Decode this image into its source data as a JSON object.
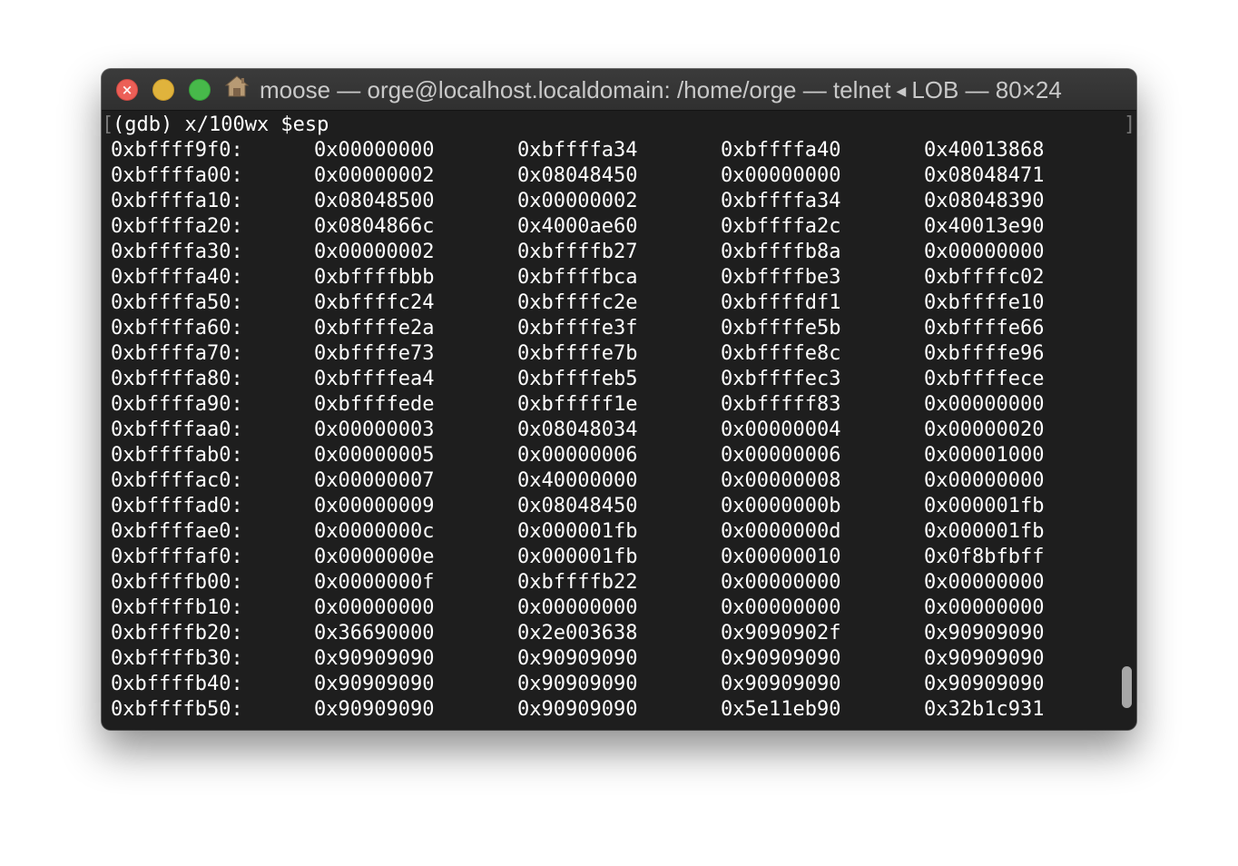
{
  "window": {
    "title_prefix": "moose — orge@localhost.localdomain: /home/orge — telnet",
    "title_suffix": "LOB — 80×24",
    "home_icon": "house-icon",
    "traffic_lights": {
      "close_color": "#ec5f57",
      "minimize_color": "#e0b33c",
      "zoom_color": "#47b94a"
    }
  },
  "terminal": {
    "prompt": "(gdb) x/100wx $esp",
    "open_bracket": "[",
    "close_bracket": "]",
    "rows": [
      {
        "addr": "0xbffff9f0:",
        "w": [
          "0x00000000",
          "0xbffffa34",
          "0xbffffa40",
          "0x40013868"
        ]
      },
      {
        "addr": "0xbffffa00:",
        "w": [
          "0x00000002",
          "0x08048450",
          "0x00000000",
          "0x08048471"
        ]
      },
      {
        "addr": "0xbffffa10:",
        "w": [
          "0x08048500",
          "0x00000002",
          "0xbffffa34",
          "0x08048390"
        ]
      },
      {
        "addr": "0xbffffa20:",
        "w": [
          "0x0804866c",
          "0x4000ae60",
          "0xbffffa2c",
          "0x40013e90"
        ]
      },
      {
        "addr": "0xbffffa30:",
        "w": [
          "0x00000002",
          "0xbffffb27",
          "0xbffffb8a",
          "0x00000000"
        ]
      },
      {
        "addr": "0xbffffa40:",
        "w": [
          "0xbffffbbb",
          "0xbffffbca",
          "0xbffffbe3",
          "0xbffffc02"
        ]
      },
      {
        "addr": "0xbffffa50:",
        "w": [
          "0xbffffc24",
          "0xbffffc2e",
          "0xbffffdf1",
          "0xbffffe10"
        ]
      },
      {
        "addr": "0xbffffa60:",
        "w": [
          "0xbffffe2a",
          "0xbffffe3f",
          "0xbffffe5b",
          "0xbffffe66"
        ]
      },
      {
        "addr": "0xbffffa70:",
        "w": [
          "0xbffffe73",
          "0xbffffe7b",
          "0xbffffe8c",
          "0xbffffe96"
        ]
      },
      {
        "addr": "0xbffffa80:",
        "w": [
          "0xbffffea4",
          "0xbffffeb5",
          "0xbffffec3",
          "0xbffffece"
        ]
      },
      {
        "addr": "0xbffffa90:",
        "w": [
          "0xbffffede",
          "0xbfffff1e",
          "0xbfffff83",
          "0x00000000"
        ]
      },
      {
        "addr": "0xbffffaa0:",
        "w": [
          "0x00000003",
          "0x08048034",
          "0x00000004",
          "0x00000020"
        ]
      },
      {
        "addr": "0xbffffab0:",
        "w": [
          "0x00000005",
          "0x00000006",
          "0x00000006",
          "0x00001000"
        ]
      },
      {
        "addr": "0xbffffac0:",
        "w": [
          "0x00000007",
          "0x40000000",
          "0x00000008",
          "0x00000000"
        ]
      },
      {
        "addr": "0xbffffad0:",
        "w": [
          "0x00000009",
          "0x08048450",
          "0x0000000b",
          "0x000001fb"
        ]
      },
      {
        "addr": "0xbffffae0:",
        "w": [
          "0x0000000c",
          "0x000001fb",
          "0x0000000d",
          "0x000001fb"
        ]
      },
      {
        "addr": "0xbffffaf0:",
        "w": [
          "0x0000000e",
          "0x000001fb",
          "0x00000010",
          "0x0f8bfbff"
        ]
      },
      {
        "addr": "0xbffffb00:",
        "w": [
          "0x0000000f",
          "0xbffffb22",
          "0x00000000",
          "0x00000000"
        ]
      },
      {
        "addr": "0xbffffb10:",
        "w": [
          "0x00000000",
          "0x00000000",
          "0x00000000",
          "0x00000000"
        ]
      },
      {
        "addr": "0xbffffb20:",
        "w": [
          "0x36690000",
          "0x2e003638",
          "0x9090902f",
          "0x90909090"
        ]
      },
      {
        "addr": "0xbffffb30:",
        "w": [
          "0x90909090",
          "0x90909090",
          "0x90909090",
          "0x90909090"
        ]
      },
      {
        "addr": "0xbffffb40:",
        "w": [
          "0x90909090",
          "0x90909090",
          "0x90909090",
          "0x90909090"
        ]
      },
      {
        "addr": "0xbffffb50:",
        "w": [
          "0x90909090",
          "0x90909090",
          "0x5e11eb90",
          "0x32b1c931"
        ]
      }
    ]
  }
}
